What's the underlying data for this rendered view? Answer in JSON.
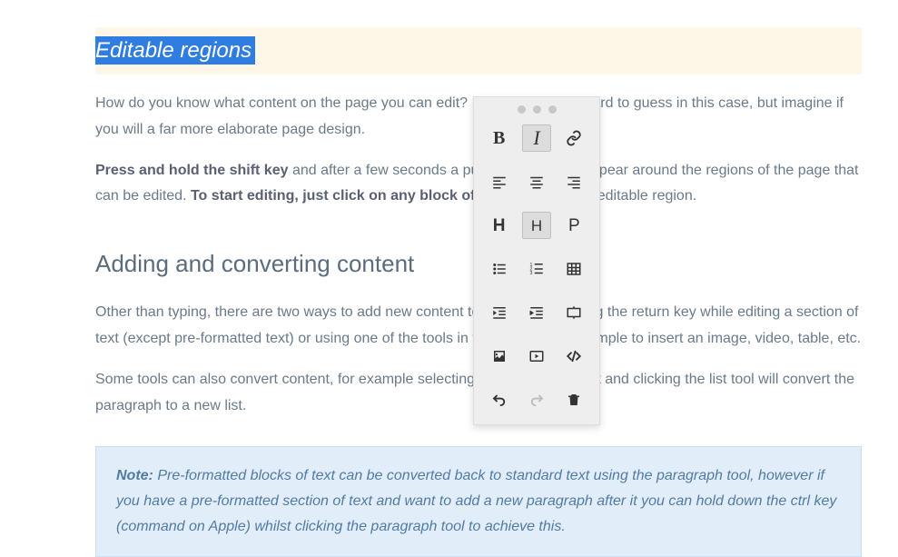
{
  "heading1": "Editable regions",
  "para1": "How do you know what content on the page you can edit? I admit it's not so hard to guess in this case, but imagine if you will a far more elaborate page design.",
  "para2_bold1": "Press and hold the shift key",
  "para2_mid": " and after a few seconds a pulsing border will appear around the regions of the page that can be edited. ",
  "para2_bold2": "To start editing, just click on any block of content",
  "para2_end": " within an editable region.",
  "heading2": "Adding and converting content",
  "para3": "Other than typing, there are two ways to add new content to the page, pressing the return key while editing a section of text (except pre-formatted text) or using one of the tools in the toolbox, for example to insert an image, video, table, etc.",
  "para4": "Some tools can also convert content, for example selecting a paragraph of text and clicking the list tool will convert the paragraph to a new list.",
  "note_label": "Note:",
  "note_body": " Pre-formatted blocks of text can be converted back to standard text using the paragraph tool, however if you have a pre-formatted section of text and want to add a new paragraph after it you can hold down the ctrl key (command on Apple) whilst clicking the paragraph tool to achieve this.",
  "toolbox": {
    "bold": "B",
    "italic": "I",
    "heading": "H",
    "subheading": "H",
    "paragraph": "P"
  }
}
